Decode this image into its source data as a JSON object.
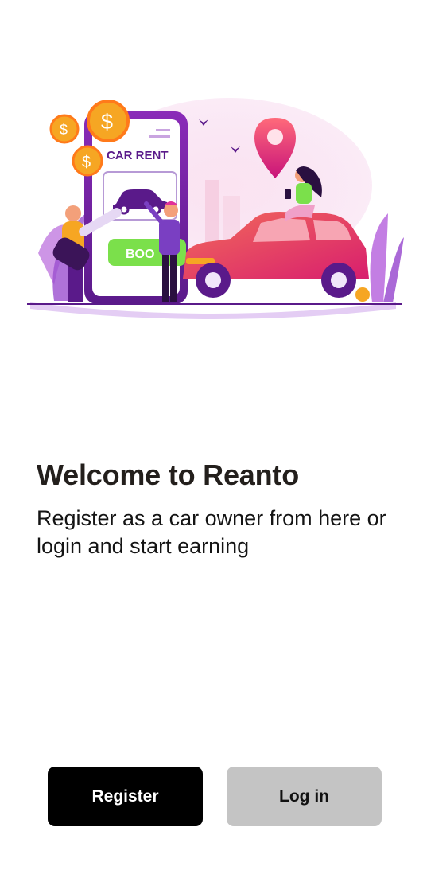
{
  "hero": {
    "illustration": "car-rent-illustration",
    "sign_text": "CAR RENT",
    "book_button_text": "BOO",
    "coin_symbol": "$",
    "colors": {
      "purple": "#7a1fa2",
      "magenta": "#e0309a",
      "coral": "#f2566a",
      "green": "#7be04b",
      "gold": "#f6a623"
    }
  },
  "welcome": {
    "title": "Welcome to Reanto",
    "subtitle": "Register as a car owner from here or login and start earning"
  },
  "actions": {
    "register_label": "Register",
    "login_label": "Log in",
    "colors": {
      "register_bg": "#000000",
      "login_bg": "#c4c4c4"
    }
  }
}
